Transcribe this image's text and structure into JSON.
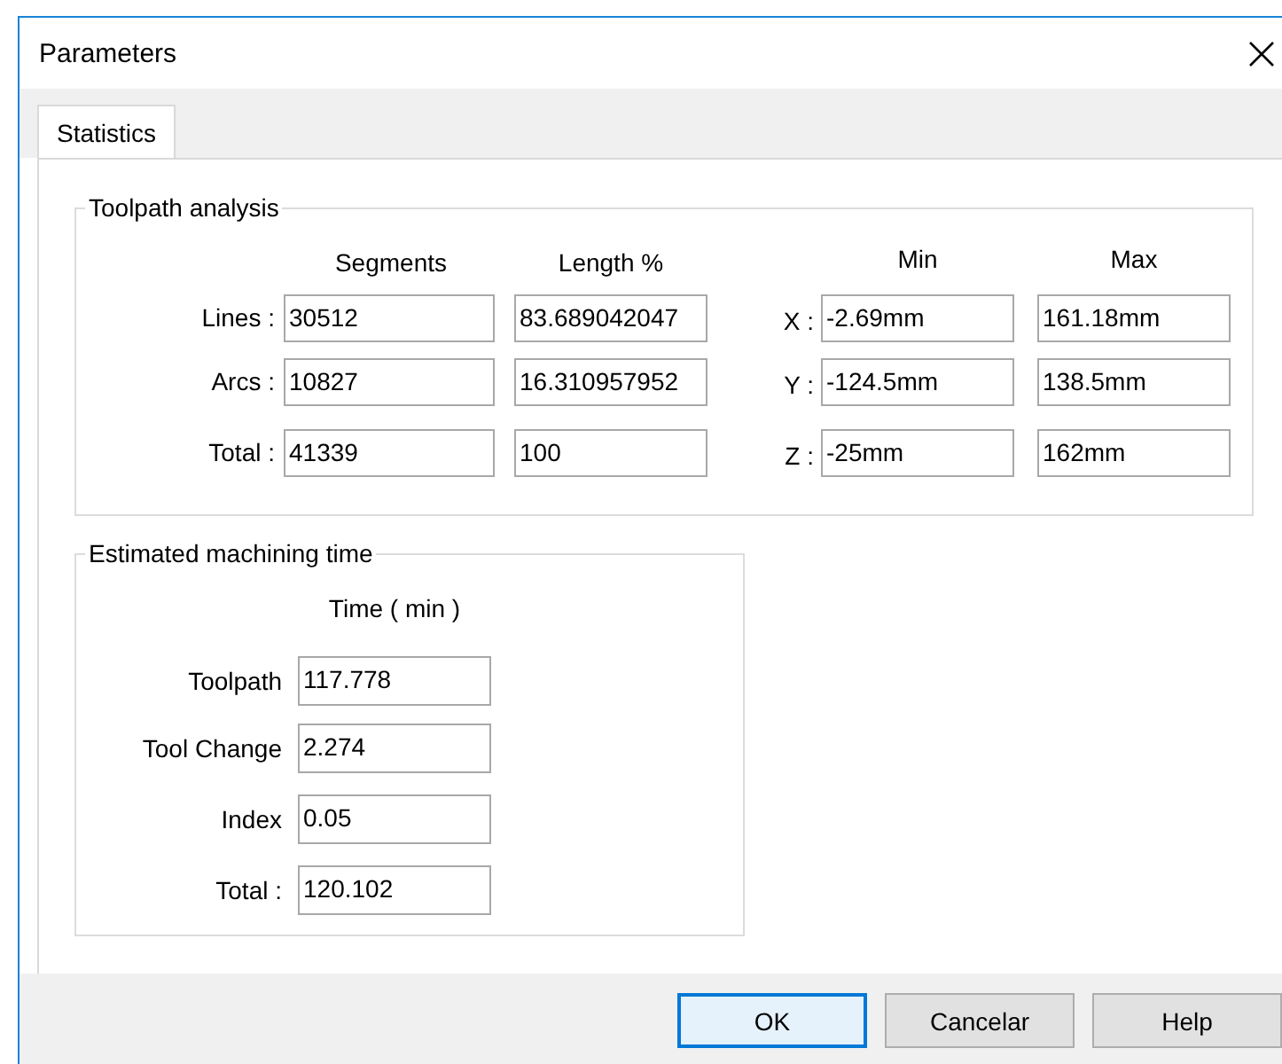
{
  "window": {
    "title": "Parameters"
  },
  "tabs": [
    {
      "label": "Statistics",
      "selected": true
    }
  ],
  "toolpath_analysis": {
    "title": "Toolpath analysis",
    "columns": [
      "Segments",
      "Length %"
    ],
    "range_columns": [
      "Min",
      "Max"
    ],
    "rows": [
      {
        "label": "Lines :",
        "segments": "30512",
        "length": "83.689042047",
        "axis": "X :",
        "min": "-2.69mm",
        "max": "161.18mm"
      },
      {
        "label": "Arcs :",
        "segments": "10827",
        "length": "16.310957952",
        "axis": "Y :",
        "min": "-124.5mm",
        "max": "138.5mm"
      },
      {
        "label": "Total :",
        "segments": "41339",
        "length": "100",
        "axis": "Z :",
        "min": "-25mm",
        "max": "162mm"
      }
    ]
  },
  "machining_time": {
    "title": "Estimated machining time",
    "column": "Time ( min )",
    "rows": [
      {
        "label": "Toolpath",
        "value": "117.778"
      },
      {
        "label": "Tool Change",
        "value": "2.274"
      },
      {
        "label": "Index",
        "value": "0.05"
      },
      {
        "label": "Total :",
        "value": "120.102"
      }
    ]
  },
  "buttons": [
    {
      "label": "OK",
      "default": true
    },
    {
      "label": "Cancelar",
      "default": false
    },
    {
      "label": "Help",
      "default": false
    }
  ]
}
